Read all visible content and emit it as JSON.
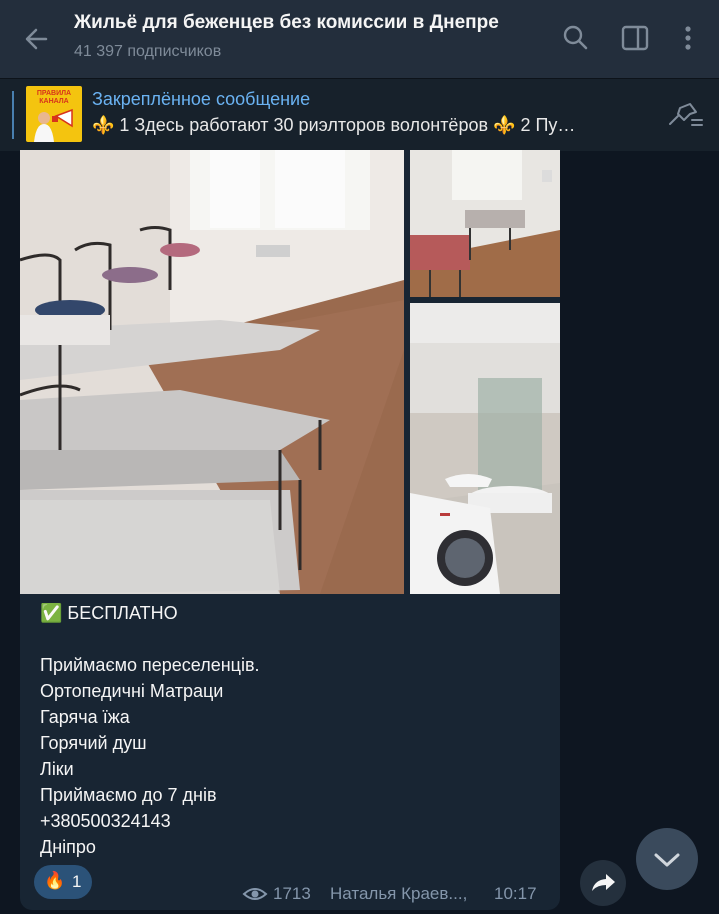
{
  "header": {
    "title": "Жильё для беженцев без комиссии в Днепре",
    "subscribers": "41 397 подписчиков"
  },
  "pinned": {
    "thumb_text": "ПРАВИЛА КАНАЛА",
    "title": "Закреплённое сообщение",
    "text": "⚜️ 1 Здесь работают 30 риэлторов волонтёров  ⚜️ 2 Пу…"
  },
  "message": {
    "line1": "✅ БЕСПЛАТНО",
    "line2": "Приймаємо переселенців.",
    "line3": "Ортопедичні Матраци",
    "line4": "Гаряча їжа",
    "line5": "Горячий душ",
    "line6": "Ліки",
    "line7": "Приймаємо до 7 днів",
    "line8": "+380500324143",
    "line9": "Дніпро",
    "reaction_emoji": "🔥",
    "reaction_count": "1",
    "views": "1713",
    "author": "Наталья Краев...,",
    "time": "10:17"
  },
  "icons": [
    "back-arrow-icon",
    "search-icon",
    "sidebar-toggle-icon",
    "more-vertical-icon",
    "unpin-icon",
    "eye-icon",
    "share-icon",
    "chevron-down-icon"
  ],
  "colors": {
    "accent": "#6ab2f2",
    "bubble": "#182533",
    "header": "#232e3c"
  }
}
